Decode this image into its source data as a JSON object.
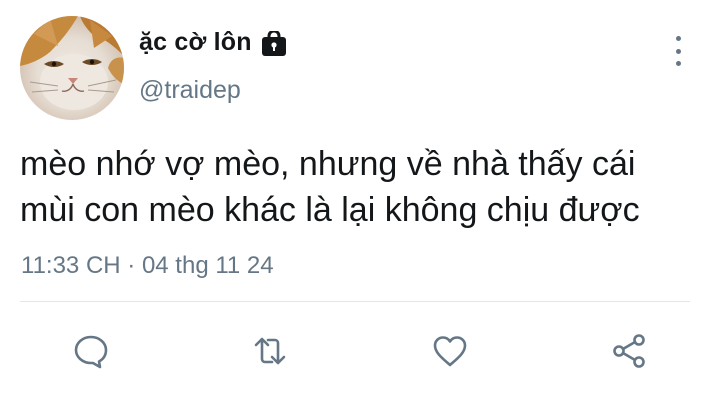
{
  "author": {
    "display_name": "ặc cờ lôn",
    "handle": "@traidep",
    "protected_icon": "lock-icon",
    "avatar": "cat-avatar"
  },
  "tweet": {
    "lines": [
      "mèo nhớ vợ mèo, nhưng về nhà thấy cái",
      "mùi con mèo khác là lại không chịu được"
    ],
    "timestamp": "11:33 CH · 04 thg 11 24"
  },
  "actions": [
    {
      "icon": "reply-icon"
    },
    {
      "icon": "retweet-icon"
    },
    {
      "icon": "like-icon"
    },
    {
      "icon": "share-icon"
    }
  ],
  "colors": {
    "text": "#14171a",
    "secondary": "#657786",
    "divider": "#e1e8ed"
  }
}
